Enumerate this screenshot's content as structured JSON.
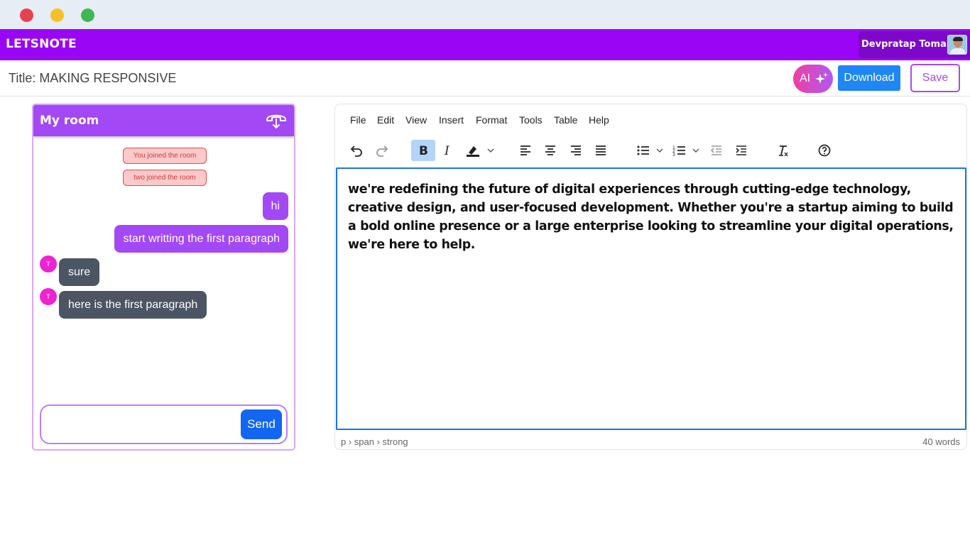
{
  "app": {
    "brand": "LETSNOTE",
    "user_name": "Devpratap Tomar"
  },
  "document": {
    "title": "Title: MAKING RESPONSIVE"
  },
  "actions": {
    "ai_label": "AI",
    "download_label": "Download",
    "save_label": "Save"
  },
  "chat": {
    "title": "My room",
    "system_messages": [
      "You joined the room",
      "two joined the room"
    ],
    "messages": [
      {
        "from": "me",
        "text": "hi"
      },
      {
        "from": "me",
        "text": "start writting the first paragraph"
      },
      {
        "from": "other",
        "avatar": "T",
        "text": "sure"
      },
      {
        "from": "other",
        "avatar": "T",
        "text": "here is the first paragraph"
      }
    ],
    "input_value": "",
    "send_label": "Send"
  },
  "editor": {
    "menu": [
      "File",
      "Edit",
      "View",
      "Insert",
      "Format",
      "Tools",
      "Table",
      "Help"
    ],
    "toolbar_icons": [
      "undo-icon",
      "redo-icon",
      "bold-icon",
      "italic-icon",
      "highlight-color-icon",
      "align-left-icon",
      "align-center-icon",
      "align-right-icon",
      "align-justify-icon",
      "bullet-list-icon",
      "numbered-list-icon",
      "outdent-icon",
      "indent-icon",
      "clear-formatting-icon",
      "help-icon"
    ],
    "content": "we're redefining the future of digital experiences through cutting-edge technology, creative design, and user-focused development. Whether you're a startup aiming to build a bold online presence or a large enterprise looking to streamline your digital operations, we're here to help.",
    "element_path": "p › span › strong",
    "word_count": "40 words"
  },
  "colors": {
    "navbar": "#9a05f5",
    "accent": "#a248f5",
    "download": "#1f86f5",
    "send": "#1366f2",
    "incoming_bubble": "#4b5563"
  }
}
